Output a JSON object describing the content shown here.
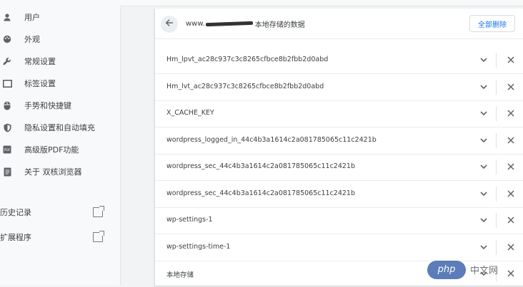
{
  "sidebar": {
    "items": [
      {
        "label": "用户",
        "icon": "person-icon"
      },
      {
        "label": "外观",
        "icon": "palette-icon"
      },
      {
        "label": "常规设置",
        "icon": "wrench-icon"
      },
      {
        "label": "标签设置",
        "icon": "tab-icon"
      },
      {
        "label": "手势和快捷键",
        "icon": "mouse-icon"
      },
      {
        "label": "隐私设置和自动填充",
        "icon": "shield-icon"
      },
      {
        "label": "高级版PDF功能",
        "icon": "pdf-icon"
      },
      {
        "label": "关于 双核浏览器",
        "icon": "info-icon"
      }
    ],
    "external": [
      {
        "label": "历史记录",
        "icon": "open-in-new-icon"
      },
      {
        "label": "扩展程序",
        "icon": "open-in-new-icon"
      }
    ]
  },
  "panel": {
    "site_prefix": "www.",
    "site_suffix": "本地存储的数据",
    "delete_all_label": "全部删除",
    "rows": [
      {
        "name": "Hm_lpvt_ac28c937c3c8265cfbce8b2fbb2d0abd"
      },
      {
        "name": "Hm_lvt_ac28c937c3c8265cfbce8b2fbb2d0abd"
      },
      {
        "name": "X_CACHE_KEY"
      },
      {
        "name": "wordpress_logged_in_44c4b3a1614c2a081785065c11c2421b"
      },
      {
        "name": "wordpress_sec_44c4b3a1614c2a081785065c11c2421b"
      },
      {
        "name": "wordpress_sec_44c4b3a1614c2a081785065c11c2421b"
      },
      {
        "name": "wp-settings-1"
      },
      {
        "name": "wp-settings-time-1"
      },
      {
        "name": "本地存储"
      }
    ]
  },
  "watermark": {
    "badge": "php",
    "text": "中文网"
  }
}
